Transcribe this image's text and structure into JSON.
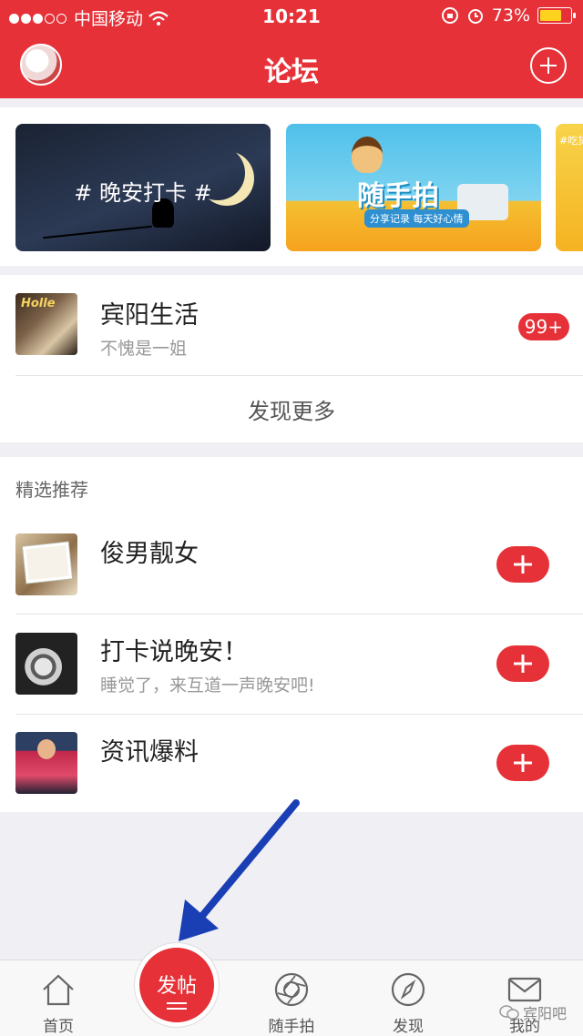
{
  "status_bar": {
    "carrier": "中国移动",
    "time": "10:21",
    "battery": "73%",
    "battery_level": 0.73
  },
  "header": {
    "title": "论坛"
  },
  "banners": [
    {
      "text": "# 晚安打卡 #"
    },
    {
      "title": "随手拍",
      "subtitle": "分享记录 每天好心情"
    },
    {
      "text": "#吃货"
    }
  ],
  "forums": [
    {
      "title": "宾阳生活",
      "subtitle": "不愧是一姐",
      "badge": "99+"
    }
  ],
  "discover_more": "发现更多",
  "recommend": {
    "heading": "精选推荐",
    "items": [
      {
        "title": "俊男靓女",
        "subtitle": ""
      },
      {
        "title": "打卡说晚安！",
        "subtitle": "睡觉了，来互道一声晚安吧!"
      },
      {
        "title": "资讯爆料",
        "subtitle": ""
      }
    ]
  },
  "tabbar": {
    "home": "首页",
    "post": "发帖",
    "snap": "随手拍",
    "discover": "发现",
    "mine": "我的"
  },
  "watermark": "宾阳吧",
  "colors": {
    "brand_red": "#e53137",
    "annotation_arrow": "#1a3fb5"
  }
}
